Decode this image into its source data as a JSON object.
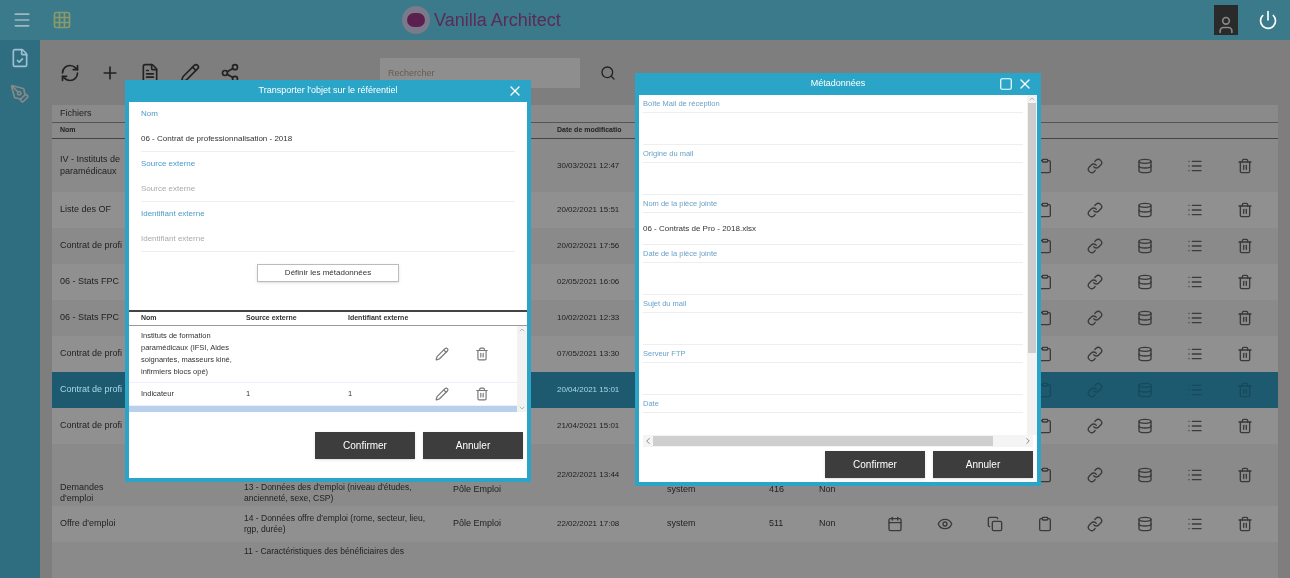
{
  "app": {
    "title": "Vanilla Architect"
  },
  "toolbar": {
    "search": {
      "placeholder": "Rechercher"
    }
  },
  "panel": {
    "tab": "Fichiers",
    "header": {
      "name": "Nom",
      "date": "Date de modificatio"
    },
    "rows": [
      {
        "name": "IV - Instituts de paramédicaux",
        "date": "30/03/2021 12:47",
        "selected": false
      },
      {
        "name": "Liste des OF",
        "date": "20/02/2021 15:51",
        "selected": false
      },
      {
        "name": "Contrat de profi",
        "date": "20/02/2021 17:56",
        "selected": false
      },
      {
        "name": "06 - Stats FPC",
        "date": "02/05/2021 16:06",
        "selected": false
      },
      {
        "name": "06 - Stats FPC",
        "date": "10/02/2021 12:33",
        "selected": false
      },
      {
        "name": "Contrat de profi",
        "date": "07/05/2021 13:30",
        "selected": false
      },
      {
        "name": "Contrat de profi",
        "date": "20/04/2021 15:01",
        "selected": true
      },
      {
        "name": "Contrat de profi",
        "date": "21/04/2021 15:01",
        "selected": false
      },
      {
        "name": "Demandes d'emploi",
        "description": "13 - Données des d'emploi (niveau d'études, ancienneté, sexe, CSP)",
        "source": "Pôle Emploi",
        "date": "22/02/2021 13:44",
        "author": "system",
        "size": "416",
        "status": "Non",
        "selected": false
      },
      {
        "name": "Offre d'emploi",
        "description": "14 - Données offre d'emploi (rome, secteur, lieu, rgp, durée)",
        "source": "Pôle Emploi",
        "date": "22/02/2021 17:08",
        "author": "system",
        "size": "511",
        "status": "Non",
        "selected": false
      },
      {
        "description": "11 - Caractéristiques des bénéficiaires des",
        "selected": false
      }
    ]
  },
  "dialog_export": {
    "title": "Transporter l'objet sur le référentiel",
    "fields": [
      {
        "label": "Nom",
        "value": "06 - Contrat de professionnalisation - 2018"
      },
      {
        "label": "Source externe",
        "placeholder": "Source externe"
      },
      {
        "label": "Identifiant externe",
        "placeholder": "Identifiant externe"
      }
    ],
    "define_button": "Définir les métadonnées",
    "table": {
      "columns": [
        "Nom",
        "Source externe",
        "Identifiant externe"
      ],
      "rows": [
        {
          "name": "Instituts de formation paramédicaux (IFSI, Aides soignantes, masseurs kiné, infirmiers blocs opé)"
        },
        {
          "name": "Indicateur",
          "source": "1",
          "id": "1"
        }
      ]
    },
    "buttons": [
      "Confirmer",
      "Annuler"
    ]
  },
  "dialog_metadata": {
    "title": "Métadonnées",
    "fields": [
      {
        "label": "Boîte Mail de réception"
      },
      {
        "label": "Origine du mail"
      },
      {
        "label": "Nom de la pièce jointe",
        "value": "06 - Contrats de Pro - 2018.xlsx"
      },
      {
        "label": "Date de la pièce jointe"
      },
      {
        "label": "Sujet du mail"
      },
      {
        "label": "Serveur FTP"
      },
      {
        "label": "Date"
      }
    ],
    "buttons": [
      "Confirmer",
      "Annuler"
    ]
  }
}
